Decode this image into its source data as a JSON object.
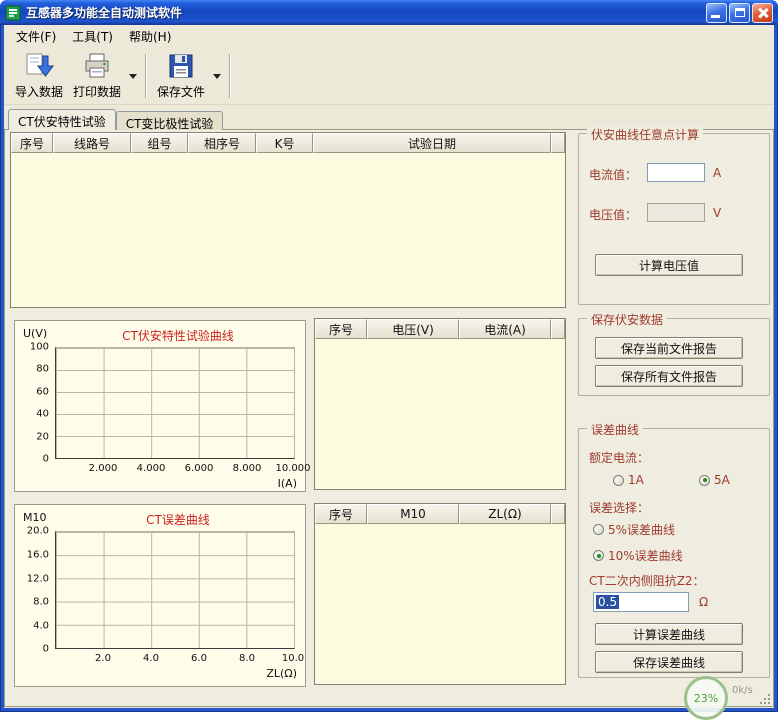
{
  "window": {
    "title": "互感器多功能全自动测试软件"
  },
  "menu": {
    "items": [
      "文件(F)",
      "工具(T)",
      "帮助(H)"
    ]
  },
  "toolbar": {
    "import": "导入数据",
    "print": "打印数据",
    "save": "保存文件"
  },
  "tabs": {
    "tab1": "CT伏安特性试验",
    "tab2": "CT变比极性试验"
  },
  "main_table": {
    "headers": [
      "序号",
      "线路号",
      "组号",
      "相序号",
      "K号",
      "试验日期",
      ""
    ]
  },
  "vi_table": {
    "headers": [
      "序号",
      "电压(V)",
      "电流(A)",
      ""
    ]
  },
  "err_table": {
    "headers": [
      "序号",
      "M10",
      "ZL(Ω)",
      ""
    ]
  },
  "chart_data": [
    {
      "type": "line",
      "title": "CT伏安特性试验曲线",
      "ylabel": "U(V)",
      "xlabel": "I(A)",
      "yticks": [
        "100",
        "80",
        "60",
        "40",
        "20",
        "0"
      ],
      "xticks": [
        "2.000",
        "4.000",
        "6.000",
        "8.000",
        "10.000"
      ],
      "xlim": [
        0,
        10
      ],
      "ylim": [
        0,
        100
      ],
      "grid": true,
      "legend": "none",
      "series": []
    },
    {
      "type": "line",
      "title": "CT误差曲线",
      "ylabel": "M10",
      "xlabel": "ZL(Ω)",
      "yticks": [
        "20.0",
        "16.0",
        "12.0",
        "8.0",
        "4.0",
        "0"
      ],
      "xticks": [
        "2.0",
        "4.0",
        "6.0",
        "8.0",
        "10.0"
      ],
      "xlim": [
        0,
        10
      ],
      "ylim": [
        0,
        20
      ],
      "grid": true,
      "legend": "none",
      "series": []
    }
  ],
  "va_calc": {
    "title": "伏安曲线任意点计算",
    "current_label": "电流值：",
    "current_value": "",
    "current_unit": "A",
    "voltage_label": "电压值：",
    "voltage_value": "",
    "voltage_unit": "V",
    "calc_button": "计算电压值"
  },
  "save_panel": {
    "title": "保存伏安数据",
    "save_current": "保存当前文件报告",
    "save_all": "保存所有文件报告"
  },
  "error_panel": {
    "title": "误差曲线",
    "rated_label": "额定电流：",
    "rated_options": [
      {
        "label": "1A",
        "checked": false
      },
      {
        "label": "5A",
        "checked": true
      }
    ],
    "select_label": "误差选择：",
    "select_options": [
      {
        "label": "5%误差曲线",
        "checked": false
      },
      {
        "label": "10%误差曲线",
        "checked": true
      }
    ],
    "z2_label": "CT二次内侧阻抗Z2：",
    "z2_value": "0.5",
    "z2_unit": "Ω",
    "calc_button": "计算误差曲线",
    "save_button": "保存误差曲线"
  },
  "overlay": {
    "percent": "23%",
    "speed": "0k/s"
  }
}
